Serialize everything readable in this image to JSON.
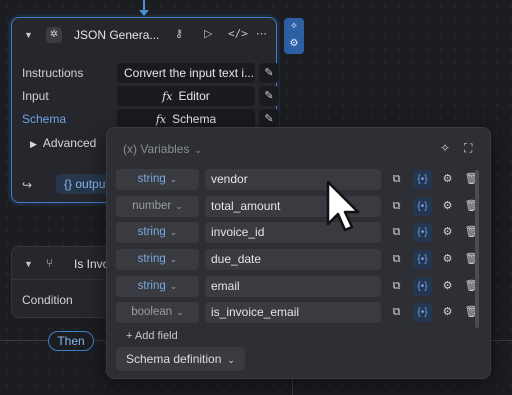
{
  "node1": {
    "title": "JSON Genera...",
    "header_icons": [
      "key-icon",
      "play-icon",
      "code-icon",
      "more-icon"
    ],
    "rows": [
      {
        "label": "Instructions",
        "value": "Convert the input text i...",
        "fx": false
      },
      {
        "label": "Input",
        "value": "Editor",
        "fx": true
      },
      {
        "label": "Schema",
        "value": "Schema",
        "fx": true
      }
    ],
    "advanced_label": "Advanced",
    "output_label": "{} output"
  },
  "node2": {
    "title": "Is Invoi",
    "condition_label": "Condition"
  },
  "then_label": "Then",
  "popover": {
    "variables_label": "(x) Variables",
    "fields": [
      {
        "type": "string",
        "name": "vendor"
      },
      {
        "type": "number",
        "name": "total_amount"
      },
      {
        "type": "string",
        "name": "invoice_id"
      },
      {
        "type": "string",
        "name": "due_date"
      },
      {
        "type": "string",
        "name": "email"
      },
      {
        "type": "boolean",
        "name": "is_invoice_email"
      }
    ],
    "add_field_label": "+ Add field",
    "schema_definition_label": "Schema definition"
  },
  "colors": {
    "accent": "#3f7fc9",
    "type_text": "#7aa8e0",
    "background": "#1c1d21",
    "panel": "#2e2f34"
  }
}
